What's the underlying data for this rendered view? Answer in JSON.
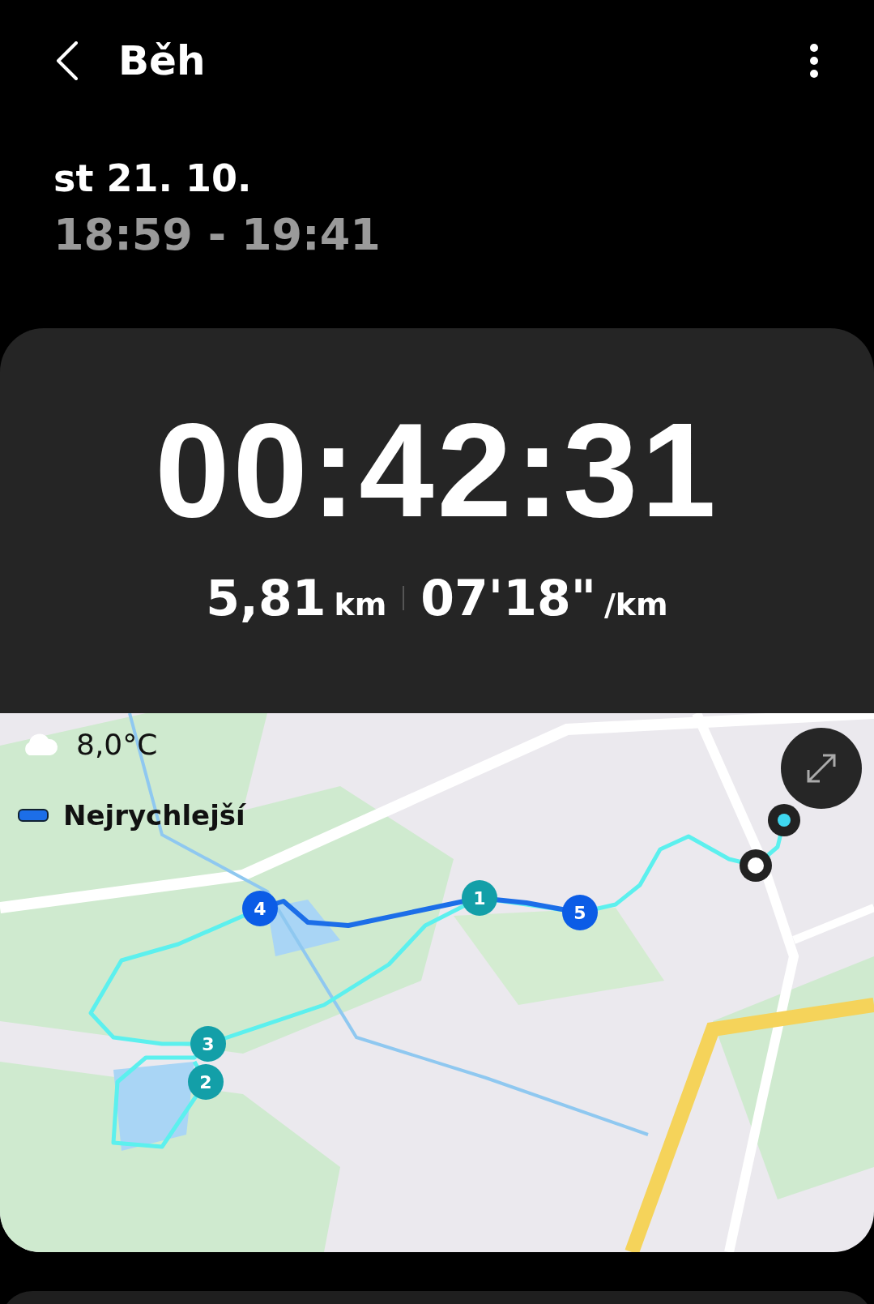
{
  "header": {
    "title": "Běh"
  },
  "date": "st 21. 10.",
  "time_range": "18:59 - 19:41",
  "summary": {
    "duration": "00:42:31",
    "distance": "5,81",
    "distance_unit": "km",
    "pace": "07'18\"",
    "pace_unit": "/km"
  },
  "map": {
    "weather": "8,0°C",
    "legend": "Nejrychlejší",
    "laps": [
      {
        "label": "1",
        "color": "#139fa8"
      },
      {
        "label": "2",
        "color": "#139fa8"
      },
      {
        "label": "3",
        "color": "#139fa8"
      },
      {
        "label": "4",
        "color": "#0b5ce6"
      },
      {
        "label": "5",
        "color": "#0b5ce6"
      }
    ]
  }
}
